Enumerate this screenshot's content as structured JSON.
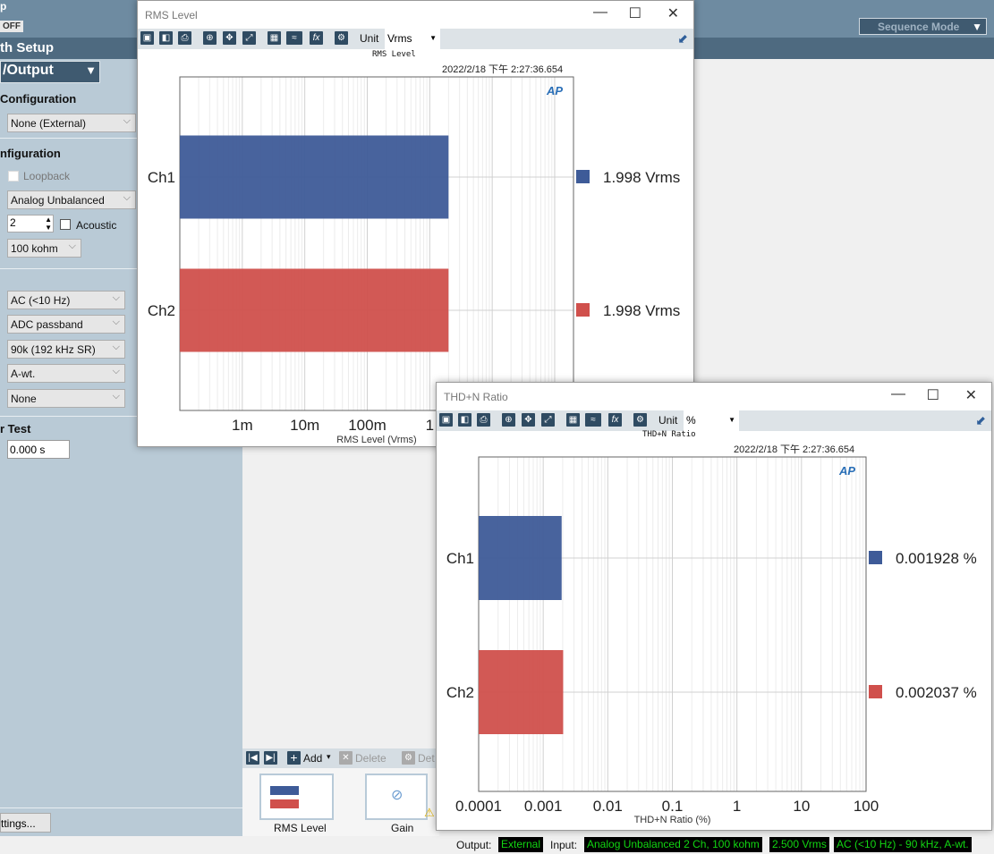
{
  "app": {
    "top_label": "p",
    "toggle": "OFF",
    "path_setup": "th Setup",
    "io_select": "/Output",
    "sequence_mode": "Sequence Mode"
  },
  "sidebar": {
    "output_config_title": "Configuration",
    "output_config_value": "None (External)",
    "input_config_title": "nfiguration",
    "loopback": "Loopback",
    "connector": "Analog Unbalanced",
    "channels": "2",
    "acoustic": "Acoustic",
    "impedance": "100 kohm",
    "coupling": "AC (<10 Hz)",
    "low_pass": "ADC passband",
    "bandwidth": "90k (192 kHz SR)",
    "weighting": "A-wt.",
    "filter": "None",
    "trigger_title": "r Test",
    "delay": "0.000 s",
    "settings_button": "ttings..."
  },
  "sequence": {
    "add": "Add",
    "delete": "Delete",
    "details": "Det",
    "thumbs": [
      {
        "label": "RMS Level"
      },
      {
        "label": "Gain",
        "warning": true
      }
    ]
  },
  "status": {
    "output_label": "Output:",
    "output_value": "External",
    "input_label": "Input:",
    "input_value": "Analog Unbalanced 2 Ch, 100 kohm",
    "range": "2.500 Vrms",
    "filter": "AC (<10 Hz) - 90 kHz, A-wt."
  },
  "windows": [
    {
      "title": "RMS Level",
      "unit_label": "Unit",
      "unit": "Vrms",
      "timestamp": "2022/2/18 下午 2:27:36.654",
      "chart_data": {
        "type": "bar",
        "orientation": "horizontal",
        "title": "RMS Level",
        "xlabel": "RMS Level (Vrms)",
        "xscale": "log",
        "xlim": [
          0.0001,
          200
        ],
        "xticks": [
          "1m",
          "10m",
          "100m",
          "1"
        ],
        "xtick_values": [
          0.001,
          0.01,
          0.1,
          1
        ],
        "grid": true,
        "categories": [
          "Ch1",
          "Ch2"
        ],
        "values": [
          1.998,
          1.998
        ],
        "value_labels": [
          "1.998  Vrms",
          "1.998  Vrms"
        ],
        "colors": [
          "#3e5b98",
          "#d0504c"
        ]
      }
    },
    {
      "title": "THD+N Ratio",
      "unit_label": "Unit",
      "unit": "%",
      "timestamp": "2022/2/18 下午 2:27:36.654",
      "chart_data": {
        "type": "bar",
        "orientation": "horizontal",
        "title": "THD+N Ratio",
        "xlabel": "THD+N Ratio (%)",
        "xscale": "log",
        "xlim": [
          0.0001,
          100
        ],
        "xticks": [
          "0.0001",
          "0.001",
          "0.01",
          "0.1",
          "1",
          "10",
          "100"
        ],
        "xtick_values": [
          0.0001,
          0.001,
          0.01,
          0.1,
          1,
          10,
          100
        ],
        "grid": true,
        "categories": [
          "Ch1",
          "Ch2"
        ],
        "values": [
          0.001928,
          0.002037
        ],
        "value_labels": [
          "0.001928  %",
          "0.002037  %"
        ],
        "colors": [
          "#3e5b98",
          "#d0504c"
        ]
      }
    }
  ]
}
